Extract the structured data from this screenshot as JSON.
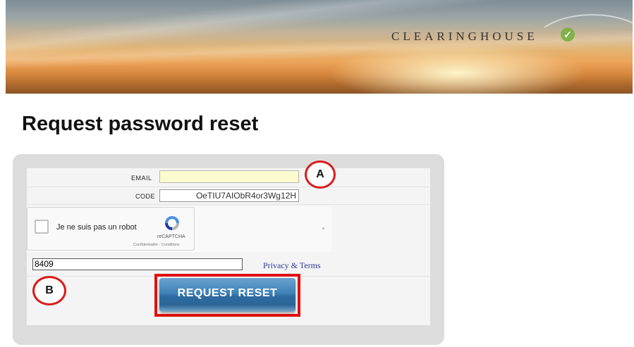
{
  "header": {
    "logo_text": "CLEARINGHOUSE",
    "logo_check": "✓"
  },
  "page": {
    "title": "Request password reset"
  },
  "form": {
    "email_label": "EMAIL",
    "email_value": "",
    "code_label": "CODE",
    "code_value": "OeTIU7AIObR4or3Wg12H",
    "recaptcha_label": "Je ne suis pas un robot",
    "recaptcha_brand": "reCAPTCHA",
    "recaptcha_links": "Confidentialité - Conditions",
    "answer_value": "8409",
    "privacy_link": "Privacy & Terms",
    "submit_label": "REQUEST RESET"
  },
  "annotations": {
    "marker_a": "A",
    "marker_b": "B"
  },
  "colors": {
    "highlight": "#e01010",
    "button": "#3f82b8",
    "email_bg": "#fbfbcd"
  }
}
